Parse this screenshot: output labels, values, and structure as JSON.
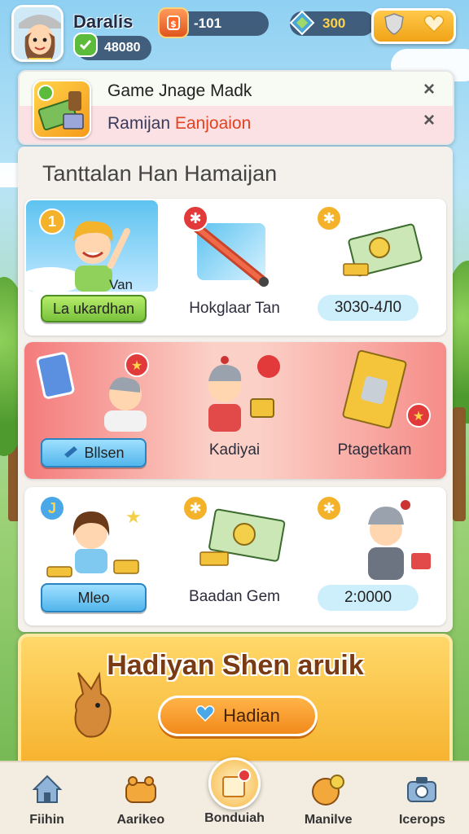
{
  "user": {
    "name": "Daralis",
    "level_value": "48080"
  },
  "currencies": [
    {
      "icon": "ruby-icon",
      "value": "-101"
    },
    {
      "icon": "gem-icon",
      "value": "300"
    }
  ],
  "notification": {
    "title": "Game Jnage Madk",
    "subtitle_prefix": "Ramijan",
    "subtitle_highlight": "Eanjoaion",
    "close_label": "×"
  },
  "section_title": "Tanttalan Han Hamaijan",
  "rows": [
    {
      "cells": [
        {
          "badge": "1",
          "caption": "Van",
          "button": "La ukardhan"
        },
        {
          "badge": "✱",
          "label": "Hokglaar Tan"
        },
        {
          "badge": "✱",
          "value": "3030-4Л0"
        }
      ]
    },
    {
      "cells": [
        {
          "button": "Bllsen"
        },
        {
          "label": "Kadiyai"
        },
        {
          "label": "Ptagetkam"
        }
      ]
    },
    {
      "cells": [
        {
          "badge": "J",
          "button": "Mleo"
        },
        {
          "badge": "✱",
          "label": "Baadan Gem"
        },
        {
          "badge": "✱",
          "value": "2:0000"
        }
      ]
    }
  ],
  "banner": {
    "title": "Hadiyan Shen aruik",
    "button": "Hadian"
  },
  "nav": [
    {
      "label": "Fiihin",
      "icon": "home-icon"
    },
    {
      "label": "Aarikeo",
      "icon": "basket-icon"
    },
    {
      "label": "Bonduiah",
      "icon": "gift-icon",
      "active": true
    },
    {
      "label": "Manilve",
      "icon": "coin-icon"
    },
    {
      "label": "Icerops",
      "icon": "camera-icon"
    }
  ],
  "colors": {
    "accent": "#f6b12c",
    "banner_text": "#7a3b14",
    "highlight": "#e2421f"
  }
}
